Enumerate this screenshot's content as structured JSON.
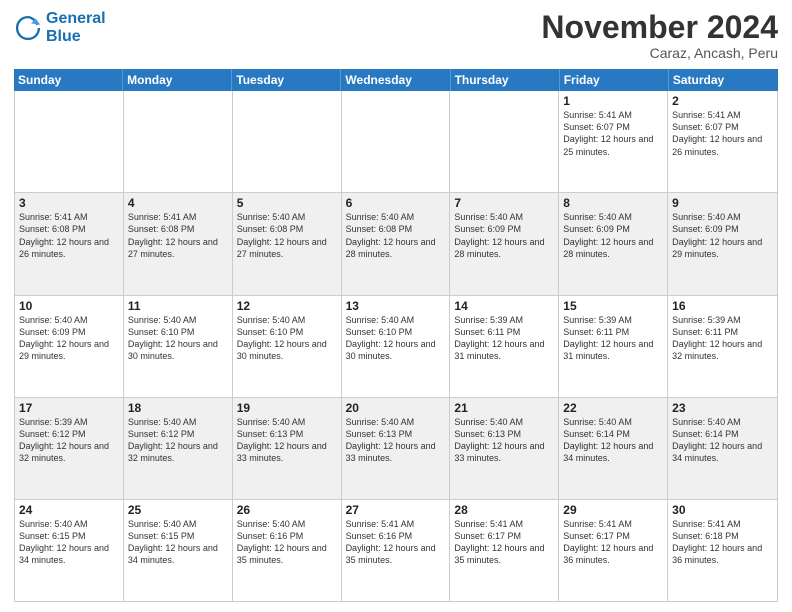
{
  "logo": {
    "line1": "General",
    "line2": "Blue"
  },
  "title": "November 2024",
  "subtitle": "Caraz, Ancash, Peru",
  "days": [
    "Sunday",
    "Monday",
    "Tuesday",
    "Wednesday",
    "Thursday",
    "Friday",
    "Saturday"
  ],
  "rows": [
    [
      {
        "num": "",
        "text": ""
      },
      {
        "num": "",
        "text": ""
      },
      {
        "num": "",
        "text": ""
      },
      {
        "num": "",
        "text": ""
      },
      {
        "num": "",
        "text": ""
      },
      {
        "num": "1",
        "text": "Sunrise: 5:41 AM\nSunset: 6:07 PM\nDaylight: 12 hours and 25 minutes."
      },
      {
        "num": "2",
        "text": "Sunrise: 5:41 AM\nSunset: 6:07 PM\nDaylight: 12 hours and 26 minutes."
      }
    ],
    [
      {
        "num": "3",
        "text": "Sunrise: 5:41 AM\nSunset: 6:08 PM\nDaylight: 12 hours and 26 minutes."
      },
      {
        "num": "4",
        "text": "Sunrise: 5:41 AM\nSunset: 6:08 PM\nDaylight: 12 hours and 27 minutes."
      },
      {
        "num": "5",
        "text": "Sunrise: 5:40 AM\nSunset: 6:08 PM\nDaylight: 12 hours and 27 minutes."
      },
      {
        "num": "6",
        "text": "Sunrise: 5:40 AM\nSunset: 6:08 PM\nDaylight: 12 hours and 28 minutes."
      },
      {
        "num": "7",
        "text": "Sunrise: 5:40 AM\nSunset: 6:09 PM\nDaylight: 12 hours and 28 minutes."
      },
      {
        "num": "8",
        "text": "Sunrise: 5:40 AM\nSunset: 6:09 PM\nDaylight: 12 hours and 28 minutes."
      },
      {
        "num": "9",
        "text": "Sunrise: 5:40 AM\nSunset: 6:09 PM\nDaylight: 12 hours and 29 minutes."
      }
    ],
    [
      {
        "num": "10",
        "text": "Sunrise: 5:40 AM\nSunset: 6:09 PM\nDaylight: 12 hours and 29 minutes."
      },
      {
        "num": "11",
        "text": "Sunrise: 5:40 AM\nSunset: 6:10 PM\nDaylight: 12 hours and 30 minutes."
      },
      {
        "num": "12",
        "text": "Sunrise: 5:40 AM\nSunset: 6:10 PM\nDaylight: 12 hours and 30 minutes."
      },
      {
        "num": "13",
        "text": "Sunrise: 5:40 AM\nSunset: 6:10 PM\nDaylight: 12 hours and 30 minutes."
      },
      {
        "num": "14",
        "text": "Sunrise: 5:39 AM\nSunset: 6:11 PM\nDaylight: 12 hours and 31 minutes."
      },
      {
        "num": "15",
        "text": "Sunrise: 5:39 AM\nSunset: 6:11 PM\nDaylight: 12 hours and 31 minutes."
      },
      {
        "num": "16",
        "text": "Sunrise: 5:39 AM\nSunset: 6:11 PM\nDaylight: 12 hours and 32 minutes."
      }
    ],
    [
      {
        "num": "17",
        "text": "Sunrise: 5:39 AM\nSunset: 6:12 PM\nDaylight: 12 hours and 32 minutes."
      },
      {
        "num": "18",
        "text": "Sunrise: 5:40 AM\nSunset: 6:12 PM\nDaylight: 12 hours and 32 minutes."
      },
      {
        "num": "19",
        "text": "Sunrise: 5:40 AM\nSunset: 6:13 PM\nDaylight: 12 hours and 33 minutes."
      },
      {
        "num": "20",
        "text": "Sunrise: 5:40 AM\nSunset: 6:13 PM\nDaylight: 12 hours and 33 minutes."
      },
      {
        "num": "21",
        "text": "Sunrise: 5:40 AM\nSunset: 6:13 PM\nDaylight: 12 hours and 33 minutes."
      },
      {
        "num": "22",
        "text": "Sunrise: 5:40 AM\nSunset: 6:14 PM\nDaylight: 12 hours and 34 minutes."
      },
      {
        "num": "23",
        "text": "Sunrise: 5:40 AM\nSunset: 6:14 PM\nDaylight: 12 hours and 34 minutes."
      }
    ],
    [
      {
        "num": "24",
        "text": "Sunrise: 5:40 AM\nSunset: 6:15 PM\nDaylight: 12 hours and 34 minutes."
      },
      {
        "num": "25",
        "text": "Sunrise: 5:40 AM\nSunset: 6:15 PM\nDaylight: 12 hours and 34 minutes."
      },
      {
        "num": "26",
        "text": "Sunrise: 5:40 AM\nSunset: 6:16 PM\nDaylight: 12 hours and 35 minutes."
      },
      {
        "num": "27",
        "text": "Sunrise: 5:41 AM\nSunset: 6:16 PM\nDaylight: 12 hours and 35 minutes."
      },
      {
        "num": "28",
        "text": "Sunrise: 5:41 AM\nSunset: 6:17 PM\nDaylight: 12 hours and 35 minutes."
      },
      {
        "num": "29",
        "text": "Sunrise: 5:41 AM\nSunset: 6:17 PM\nDaylight: 12 hours and 36 minutes."
      },
      {
        "num": "30",
        "text": "Sunrise: 5:41 AM\nSunset: 6:18 PM\nDaylight: 12 hours and 36 minutes."
      }
    ]
  ]
}
